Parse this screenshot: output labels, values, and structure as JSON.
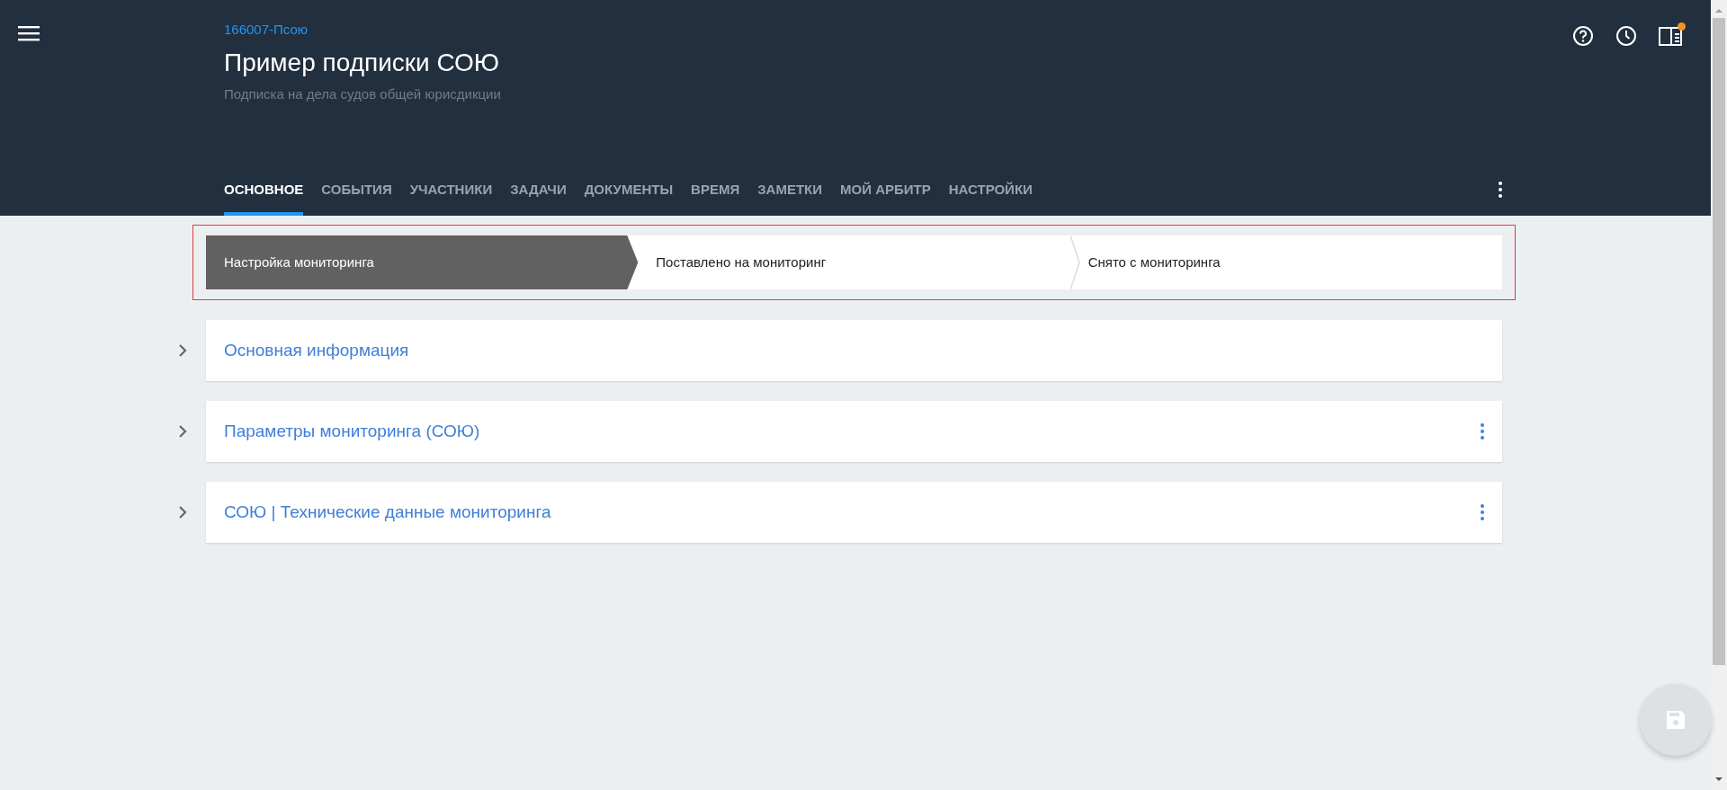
{
  "header": {
    "case_id": "166007-Псою",
    "title": "Пример подписки СОЮ",
    "subtitle": "Подписка на дела судов общей юрисдикции",
    "panel_notification": true
  },
  "tabs": [
    {
      "label": "ОСНОВНОЕ",
      "selected": true
    },
    {
      "label": "СОБЫТИЯ",
      "selected": false
    },
    {
      "label": "УЧАСТНИКИ",
      "selected": false
    },
    {
      "label": "ЗАДАЧИ",
      "selected": false
    },
    {
      "label": "ДОКУМЕНТЫ",
      "selected": false
    },
    {
      "label": "ВРЕМЯ",
      "selected": false
    },
    {
      "label": "ЗАМЕТКИ",
      "selected": false
    },
    {
      "label": "МОЙ АРБИТР",
      "selected": false
    },
    {
      "label": "НАСТРОЙКИ",
      "selected": false
    }
  ],
  "stages": [
    {
      "label": "Настройка мониторинга",
      "selected": true
    },
    {
      "label": "Поставлено на мониторинг",
      "selected": false
    },
    {
      "label": "Снято с мониторинга",
      "selected": false
    }
  ],
  "sections": [
    {
      "title": "Основная информация",
      "expanded": false,
      "has_menu": false
    },
    {
      "title": "Параметры мониторинга (СОЮ)",
      "expanded": false,
      "has_menu": true
    },
    {
      "title": "СОЮ | Технические данные мониторинга",
      "expanded": false,
      "has_menu": true
    }
  ],
  "save_button": {
    "disabled": true
  }
}
